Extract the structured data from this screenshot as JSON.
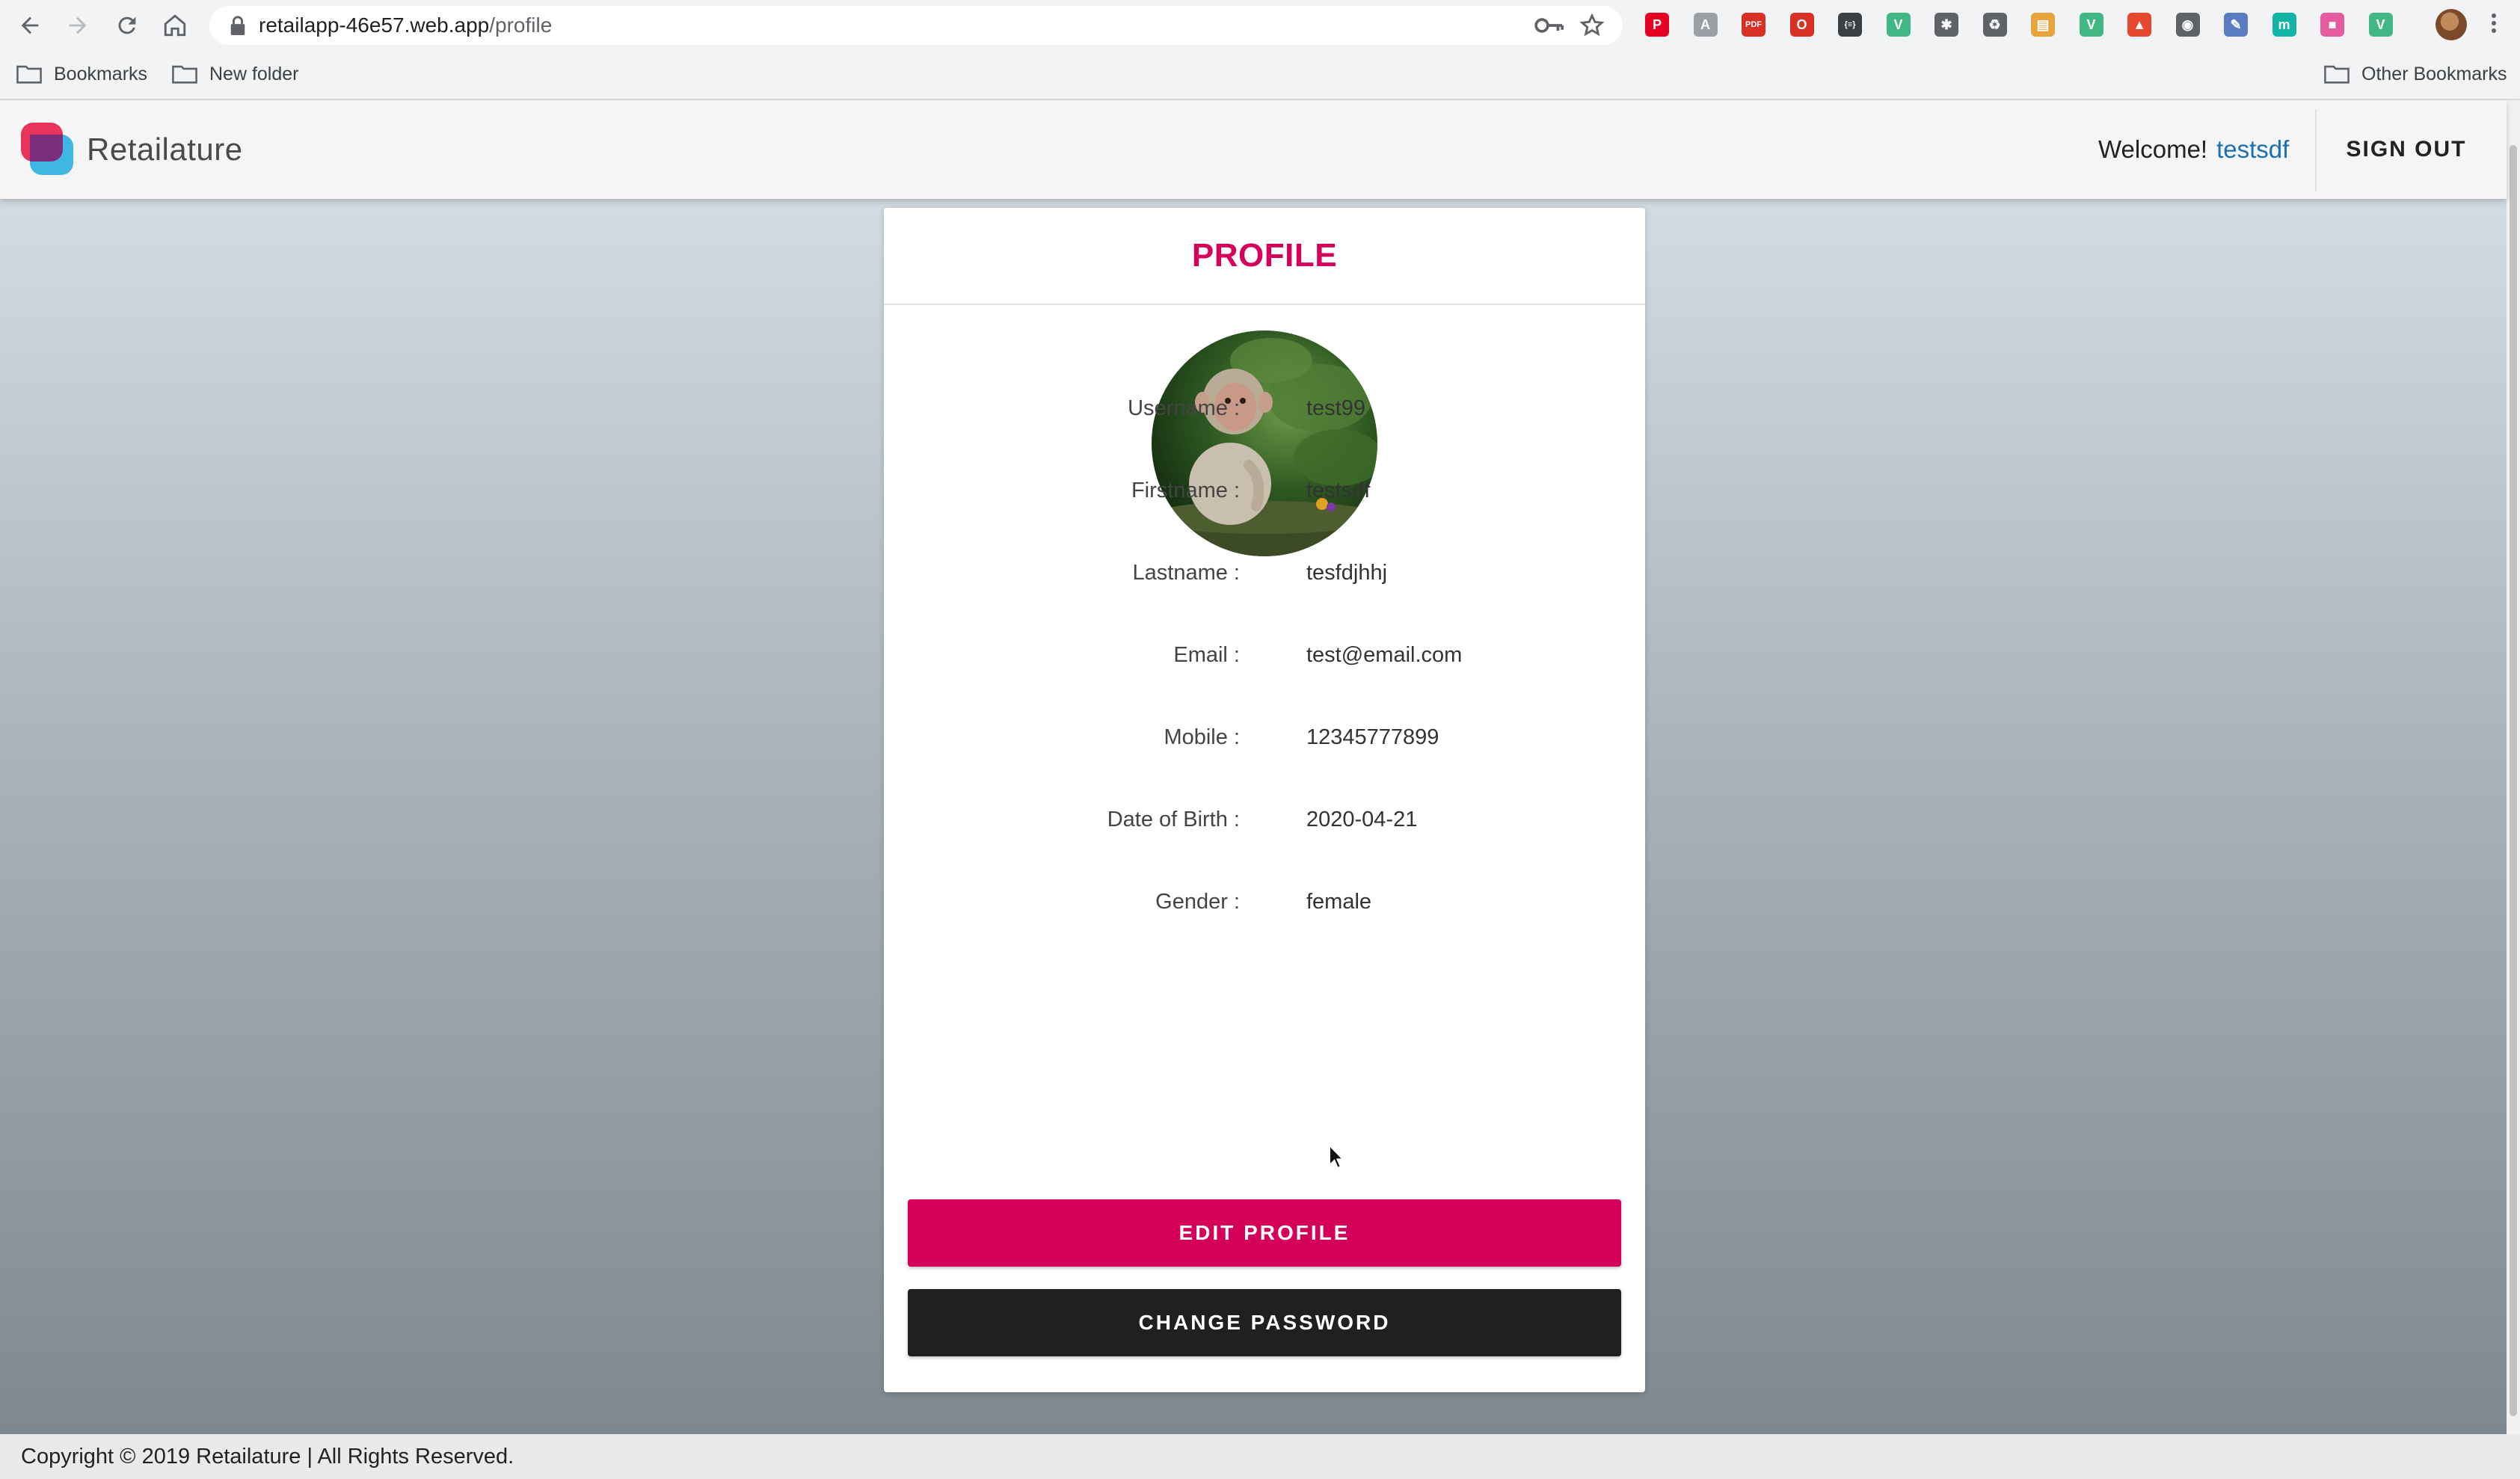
{
  "browser": {
    "url_host": "retailapp-46e57.web.app",
    "url_path": "/profile",
    "extensions": [
      {
        "icon": "pinterest-icon",
        "color": "#e60023",
        "glyph": "P"
      },
      {
        "icon": "text-extension-icon",
        "color": "#9aa0a6",
        "glyph": "A"
      },
      {
        "icon": "pdf-extension-icon",
        "color": "#d93025",
        "glyph": "PDF"
      },
      {
        "icon": "opera-icon",
        "color": "#d93025",
        "glyph": "O"
      },
      {
        "icon": "json-icon",
        "color": "#3c4043",
        "glyph": "{≡}"
      },
      {
        "icon": "vue-devtools-icon",
        "color": "#41b883",
        "glyph": "V"
      },
      {
        "icon": "bug-icon",
        "color": "#5f6368",
        "glyph": "✱"
      },
      {
        "icon": "recycle-icon",
        "color": "#5f6368",
        "glyph": "♻"
      },
      {
        "icon": "calendar-icon",
        "color": "#e8a33d",
        "glyph": "▤"
      },
      {
        "icon": "vue-icon",
        "color": "#41b883",
        "glyph": "V"
      },
      {
        "icon": "lighthouse-icon",
        "color": "#e8472f",
        "glyph": "▲"
      },
      {
        "icon": "camera-icon",
        "color": "#5f6368",
        "glyph": "◉"
      },
      {
        "icon": "feather-icon",
        "color": "#5a7dbf",
        "glyph": "✎"
      },
      {
        "icon": "m-extension-icon",
        "color": "#12b5a5",
        "glyph": "m"
      },
      {
        "icon": "gradient-extension-icon",
        "color": "#e65aa0",
        "glyph": "■"
      },
      {
        "icon": "vue-icon-2",
        "color": "#41b883",
        "glyph": "V"
      }
    ]
  },
  "bookmarks_bar": {
    "bookmarks_label": "Bookmarks",
    "new_folder_label": "New folder",
    "other_bookmarks_label": "Other Bookmarks"
  },
  "header": {
    "brand": "Retailature",
    "welcome_text": "Welcome!",
    "username": "testsdf",
    "sign_out_label": "SIGN OUT"
  },
  "profile": {
    "title": "PROFILE",
    "fields": [
      {
        "label": "Username :",
        "value": "test99"
      },
      {
        "label": "Firstname :",
        "value": "testsdf"
      },
      {
        "label": "Lastname :",
        "value": "tesfdjhhj"
      },
      {
        "label": "Email :",
        "value": "test@email.com"
      },
      {
        "label": "Mobile :",
        "value": "12345777899"
      },
      {
        "label": "Date of Birth :",
        "value": "2020-04-21"
      },
      {
        "label": "Gender :",
        "value": "female"
      }
    ],
    "edit_button": "EDIT PROFILE",
    "change_password_button": "CHANGE PASSWORD"
  },
  "footer": {
    "copyright": "Copyright © 2019 Retailature | All Rights Reserved."
  },
  "colors": {
    "accent": "#d4005a",
    "dark_button": "#202020",
    "link": "#1a6fb5"
  }
}
